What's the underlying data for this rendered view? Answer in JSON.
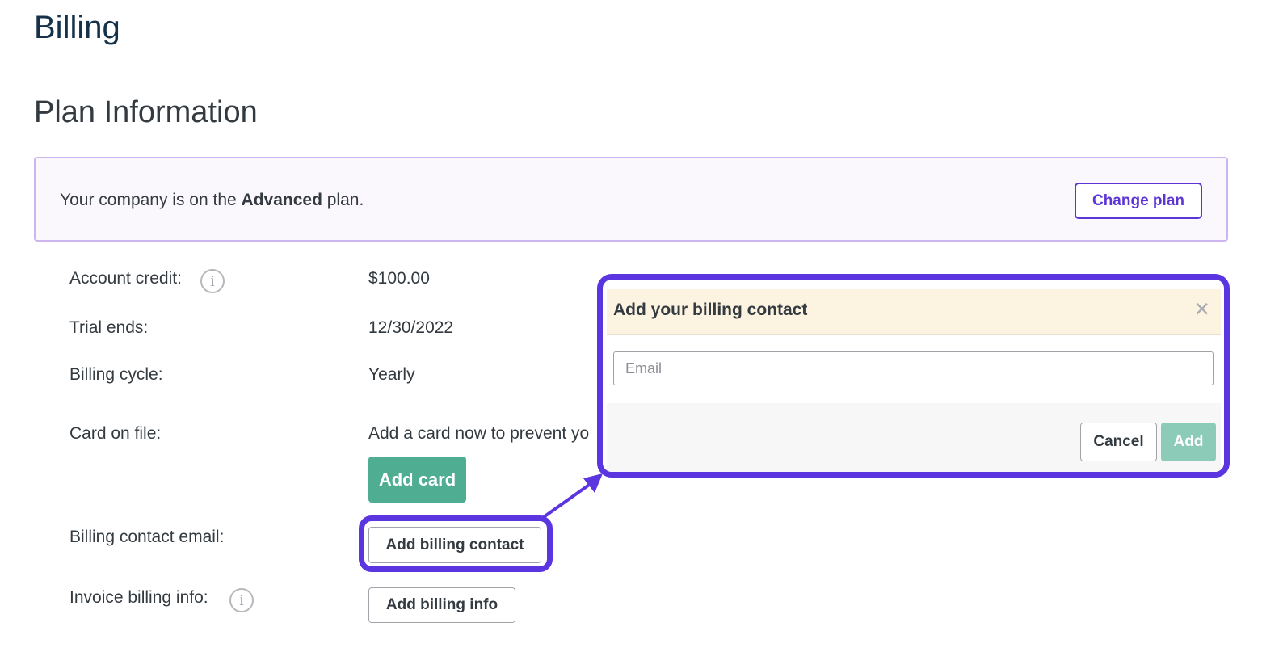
{
  "page": {
    "title": "Billing",
    "section_title": "Plan Information"
  },
  "plan": {
    "text_prefix": "Your company is on the ",
    "plan_name": "Advanced",
    "text_suffix": " plan.",
    "change_button": "Change plan"
  },
  "details": {
    "account_credit_label": "Account credit:",
    "account_credit_value": "$100.00",
    "trial_ends_label": "Trial ends:",
    "trial_ends_value": "12/30/2022",
    "billing_cycle_label": "Billing cycle:",
    "billing_cycle_value": "Yearly",
    "card_on_file_label": "Card on file:",
    "card_on_file_value": "Add a card now to prevent yo",
    "add_card_button": "Add card",
    "billing_contact_label": "Billing contact email:",
    "add_billing_contact_button": "Add billing contact",
    "invoice_label": "Invoice billing info:",
    "add_billing_info_button": "Add billing info",
    "info_icon_glyph": "i"
  },
  "popup": {
    "title": "Add your billing contact",
    "close_glyph": "×",
    "email_value": "",
    "email_placeholder": "Email",
    "cancel_button": "Cancel",
    "add_button": "Add"
  },
  "colors": {
    "accent_purple": "#5b35e0",
    "add_card_green": "#4fae92",
    "add_disabled_green": "#8ccbb7",
    "popup_header_bg": "#fdf3e1"
  },
  "icons": {
    "info": "info-circle-icon",
    "close": "close-icon",
    "arrow": "arrow-icon"
  }
}
